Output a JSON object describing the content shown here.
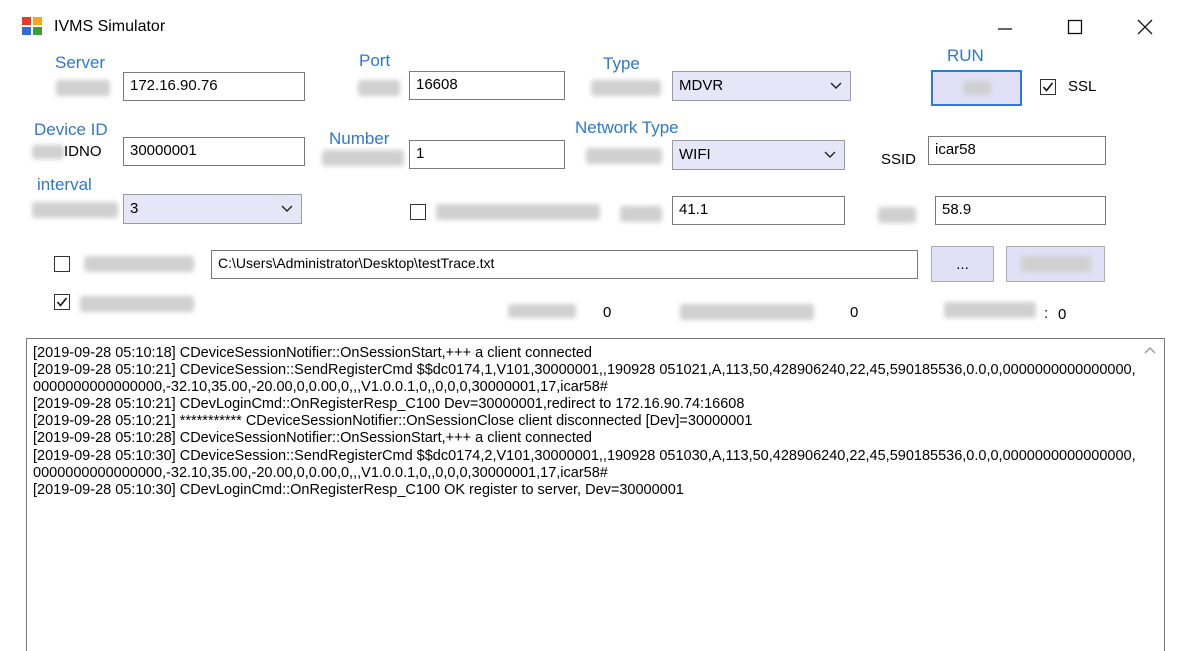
{
  "window": {
    "title": "IVMS Simulator"
  },
  "annotations": {
    "server": "Server",
    "port": "Port",
    "type": "Type",
    "run": "RUN",
    "device_id": "Device ID",
    "number": "Number",
    "network_type": "Network Type",
    "interval": "interval"
  },
  "form": {
    "server_value": "172.16.90.76",
    "port_value": "16608",
    "type_value": "MDVR",
    "ssl_label": "SSL",
    "idno_label": "IDNO",
    "device_id_value": "30000001",
    "number_value": "1",
    "network_type_value": "WIFI",
    "ssid_label": "SSID",
    "ssid_value": "icar58",
    "interval_value": "3",
    "longitude_value": "41.1",
    "latitude_value": "58.9",
    "trace_path": "C:\\Users\\Administrator\\Desktop\\testTrace.txt",
    "browse_label": "...",
    "count_1": "0",
    "count_2": "0",
    "count_3_sep": ":",
    "count_3": "0"
  },
  "log": [
    "[2019-09-28 05:10:18] CDeviceSessionNotifier::OnSessionStart,+++ a client connected",
    "[2019-09-28 05:10:21] CDeviceSession::SendRegisterCmd $$dc0174,1,V101,30000001,,190928 051021,A,113,50,428906240,22,45,590185536,0.0,0,0000000000000000,0000000000000000,-32.10,35.00,-20.00,0,0.00,0,,,V1.0.0.1,0,,0,0,0,30000001,17,icar58#",
    "[2019-09-28 05:10:21] CDevLoginCmd::OnRegisterResp_C100 Dev=30000001,redirect to 172.16.90.74:16608",
    "[2019-09-28 05:10:21] *********** CDeviceSessionNotifier::OnSessionClose client disconnected [Dev]=30000001",
    "[2019-09-28 05:10:28] CDeviceSessionNotifier::OnSessionStart,+++ a client connected",
    "[2019-09-28 05:10:30] CDeviceSession::SendRegisterCmd $$dc0174,2,V101,30000001,,190928 051030,A,113,50,428906240,22,45,590185536,0.0,0,0000000000000000,0000000000000000,-32.10,35.00,-20.00,0,0.00,0,,,V1.0.0.1,0,,0,0,0,30000001,17,icar58#",
    "[2019-09-28 05:10:30] CDevLoginCmd::OnRegisterResp_C100 OK register to server, Dev=30000001"
  ]
}
